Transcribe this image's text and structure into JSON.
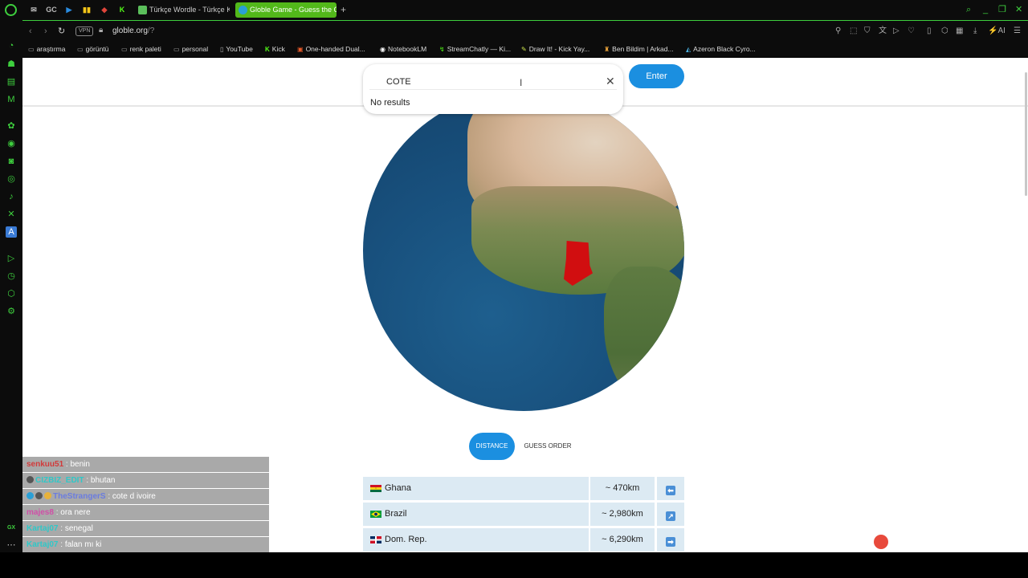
{
  "tabs": {
    "pinned": [
      "inbox",
      "GC",
      "play",
      "bars",
      "game",
      "K"
    ],
    "items": [
      {
        "title": "Türkçe Wordle - Türkçe Ke",
        "favicon_color": "#5bbf5b",
        "active": false
      },
      {
        "title": "Globle Game - Guess the C",
        "favicon_color": "#2a9fd6",
        "active": true
      }
    ],
    "new_tab": "+"
  },
  "address": {
    "vpn": "VPN",
    "host": "globle.org",
    "path": "/?"
  },
  "bookmarks": [
    {
      "label": "araştırma",
      "icon": "folder-icon"
    },
    {
      "label": "görüntü",
      "icon": "folder-icon"
    },
    {
      "label": "renk paleti",
      "icon": "folder-icon"
    },
    {
      "label": "personal",
      "icon": "folder-icon"
    },
    {
      "label": "YouTube",
      "icon": "page-icon"
    },
    {
      "label": "Kick",
      "icon": "kick-icon"
    },
    {
      "label": "One-handed Dual...",
      "icon": "page-icon"
    },
    {
      "label": "NotebookLM",
      "icon": "notebook-icon"
    },
    {
      "label": "StreamChatly — Ki...",
      "icon": "page-icon"
    },
    {
      "label": "Draw It! - Kick Yay...",
      "icon": "page-icon"
    },
    {
      "label": "Ben Bildim | Arkad...",
      "icon": "page-icon"
    },
    {
      "label": "Azeron Black Cyro...",
      "icon": "page-icon"
    }
  ],
  "search": {
    "value": "COTE",
    "no_results": "No results",
    "enter_label": "Enter"
  },
  "toggle": {
    "distance": "DISTANCE",
    "guess_order": "GUESS ORDER"
  },
  "guesses": [
    {
      "country": "Ghana",
      "distance": "~ 470km",
      "direction": "⬅",
      "flag": "ghana"
    },
    {
      "country": "Brazil",
      "distance": "~ 2,980km",
      "direction": "↗",
      "flag": "brazil"
    },
    {
      "country": "Dom. Rep.",
      "distance": "~ 6,290km",
      "direction": "➡",
      "flag": "domrep"
    }
  ],
  "chat": [
    {
      "user": "senkuu51",
      "user_color": "#d23a3a",
      "msg": "benin"
    },
    {
      "user": "CIZBIZ_EDIT",
      "user_color": "#2ec8c8",
      "msg": "bhutan"
    },
    {
      "user": "TheStrangerS",
      "user_color": "#6a7ce0",
      "msg": "cote d ivoire"
    },
    {
      "user": "majes8",
      "user_color": "#d04fa8",
      "msg": "ora nere"
    },
    {
      "user": "Kartaj07",
      "user_color": "#2ec8c8",
      "msg": "senegal"
    },
    {
      "user": "Kartaj07",
      "user_color": "#2ec8c8",
      "msg": "falan mı ki"
    }
  ],
  "colors": {
    "accent": "#1b8fe0",
    "browser_accent": "#3ecf3e",
    "target_country": "#d10e10"
  }
}
